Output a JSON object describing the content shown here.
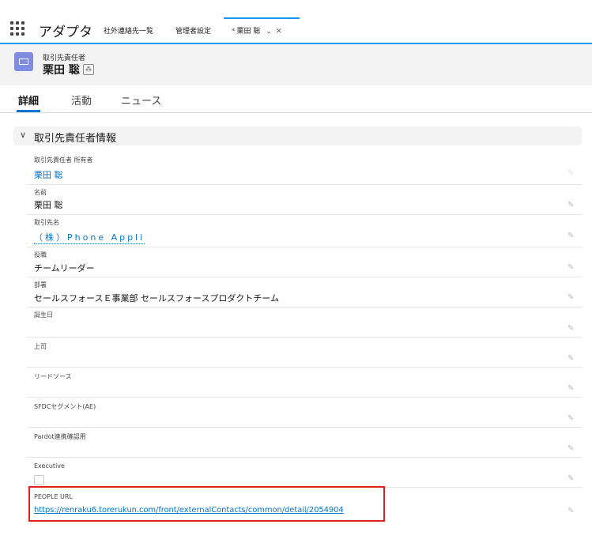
{
  "nav": {
    "app_name": "アダプタ",
    "tabs": [
      "社外連絡先一覧",
      "管理者設定"
    ],
    "active_tab": {
      "prefix": "*",
      "label": "栗田 聡"
    }
  },
  "record": {
    "object_type": "取引先責任者",
    "name": "栗田 聡"
  },
  "subtabs": [
    "詳細",
    "活動",
    "ニュース"
  ],
  "section": {
    "title": "取引先責任者情報"
  },
  "fields": [
    {
      "label": "取引先責任者 所有者",
      "value": "栗田 聡"
    },
    {
      "label": "名前",
      "value": "栗田 聡"
    },
    {
      "label": "取引先名",
      "value": "（株）Phone Appli"
    },
    {
      "label": "役職",
      "value": "チームリーダー"
    },
    {
      "label": "部署",
      "value": "セールスフォースＥ事業部 セールスフォースプロダクトチーム"
    },
    {
      "label": "誕生日",
      "value": ""
    },
    {
      "label": "上司",
      "value": ""
    },
    {
      "label": "リードソース",
      "value": ""
    },
    {
      "label": "SFDCセグメント(AE)",
      "value": ""
    },
    {
      "label": "Pardot連携確認用",
      "value": ""
    },
    {
      "label": "Executive",
      "checked": false
    },
    {
      "label": "PEOPLE URL",
      "value": "https://renraku6.torerukun.com/front/externalContacts/common/detail/2054904"
    }
  ],
  "colors": {
    "accent": "#0176d3",
    "highlight": "#e0211b",
    "object_icon": "#7f8de1"
  }
}
